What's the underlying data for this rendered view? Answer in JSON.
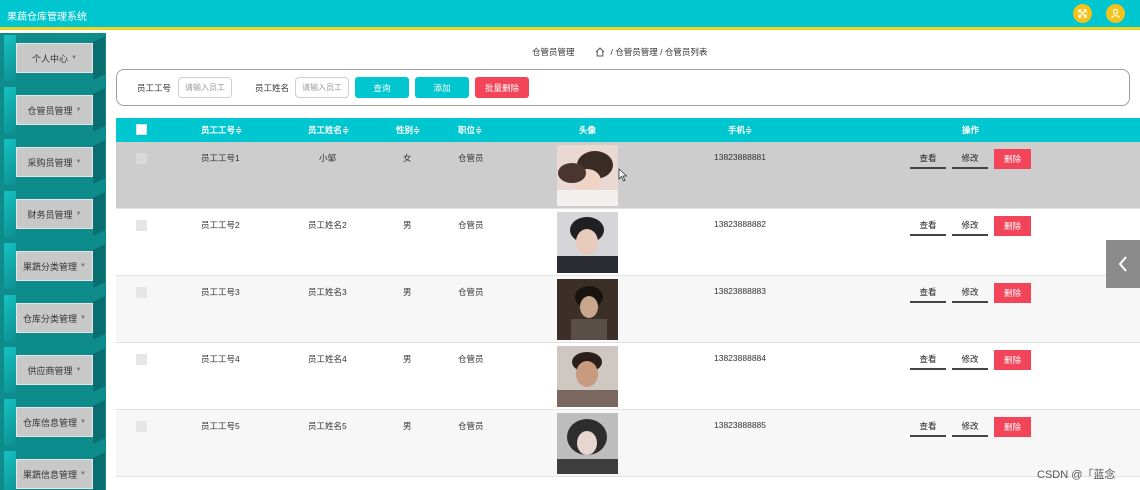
{
  "app": {
    "title": "果蔬仓库管理系统"
  },
  "colors": {
    "accent": "#00c6cf",
    "danger": "#f2455a",
    "topbar_border": "#f4d21f",
    "sidebar_bg": "#0e8c8c"
  },
  "topbar": {
    "icons": [
      "expand-icon",
      "user-icon"
    ]
  },
  "sidebar": {
    "items": [
      {
        "label": "个人中心"
      },
      {
        "label": "仓管员管理"
      },
      {
        "label": "采购员管理"
      },
      {
        "label": "财务员管理"
      },
      {
        "label": "果蔬分类管理"
      },
      {
        "label": "仓库分类管理"
      },
      {
        "label": "供应商管理"
      },
      {
        "label": "仓库信息管理"
      },
      {
        "label": "果蔬信息管理"
      }
    ]
  },
  "breadcrumb": {
    "section": "仓管员管理",
    "path": "/ 仓管员管理 / 仓管员列表"
  },
  "search": {
    "field1_label": "员工工号",
    "field1_placeholder": "请输入员工",
    "field2_label": "员工姓名",
    "field2_placeholder": "请输入员工",
    "query_label": "查询",
    "add_label": "添加",
    "batch_delete_label": "批量删除"
  },
  "table": {
    "headers": [
      "员工工号≑",
      "员工姓名≑",
      "性别≑",
      "职位≑",
      "头像",
      "手机≑",
      "操作"
    ],
    "rows": [
      {
        "id": "员工工号1",
        "name": "小邹",
        "gender": "女",
        "position": "仓管员",
        "phone": "13823888881",
        "highlighted": true
      },
      {
        "id": "员工工号2",
        "name": "员工姓名2",
        "gender": "男",
        "position": "仓管员",
        "phone": "13823888882",
        "highlighted": false
      },
      {
        "id": "员工工号3",
        "name": "员工姓名3",
        "gender": "男",
        "position": "仓管员",
        "phone": "13823888883",
        "highlighted": false
      },
      {
        "id": "员工工号4",
        "name": "员工姓名4",
        "gender": "男",
        "position": "仓管员",
        "phone": "13823888884",
        "highlighted": false
      },
      {
        "id": "员工工号5",
        "name": "员工姓名5",
        "gender": "男",
        "position": "仓管员",
        "phone": "13823888885",
        "highlighted": false
      }
    ],
    "actions": {
      "view": "查看",
      "edit": "修改",
      "delete": "删除"
    }
  },
  "watermark": "CSDN @「蓝念"
}
